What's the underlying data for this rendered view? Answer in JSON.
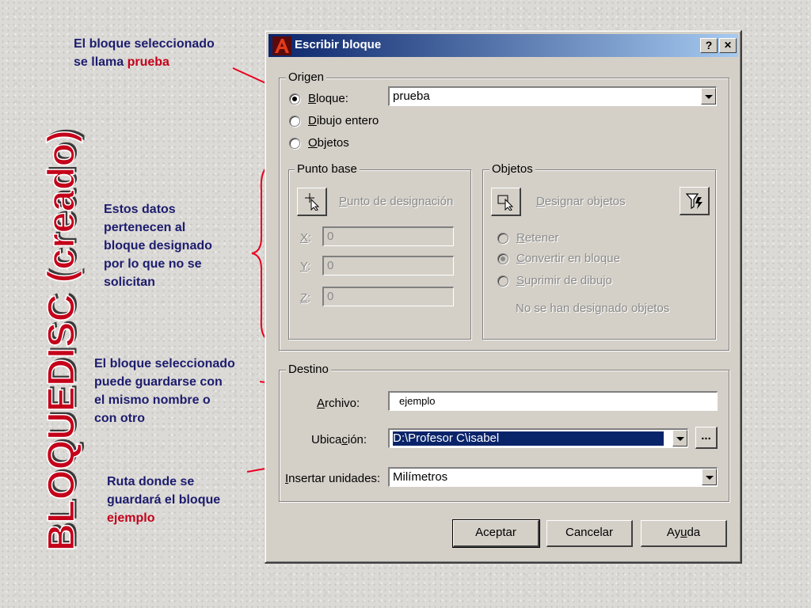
{
  "slide": {
    "title": "BLOQUEDISC (creado)",
    "title_color": "#c4001a",
    "annotations": {
      "a1_line1": "El bloque seleccionado",
      "a1_line2_pre": "se llama ",
      "a1_line2_hl": "prueba",
      "a2_lines": [
        "Estos datos",
        "pertenecen al",
        "bloque designado",
        "por lo que no se",
        "solicitan"
      ],
      "a3_lines": [
        "El bloque seleccionado",
        "puede guardarse con",
        "el mismo nombre o",
        "con otro"
      ],
      "a4_line1": "Ruta donde se",
      "a4_line2": "guardará el bloque",
      "a4_line3_hl": "ejemplo"
    }
  },
  "dialog": {
    "title": "Escribir bloque",
    "help_btn": "?",
    "close_btn": "✕",
    "origen": {
      "legend": "Origen",
      "radio_bloque_u": "B",
      "radio_bloque_rest": "loque:",
      "radio_dibujo_u": "D",
      "radio_dibujo_rest": "ibujo entero",
      "radio_objetos_u": "O",
      "radio_objetos_rest": "bjetos",
      "bloque_value": "prueba"
    },
    "punto_base": {
      "legend": "Punto base",
      "pick_u": "P",
      "pick_rest": "unto de designación",
      "x_u": "X",
      "y_u": "Y",
      "z_u": "Z",
      "x_value": "0",
      "y_value": "0",
      "z_value": "0"
    },
    "objetos": {
      "legend": "Objetos",
      "select_u": "D",
      "select_rest": "esignar objetos",
      "retener_u": "R",
      "retener_rest": "etener",
      "convertir_u": "C",
      "convertir_rest": "onvertir en bloque",
      "suprimir_u": "S",
      "suprimir_rest": "uprimir de dibujo",
      "status": "No se han designado objetos"
    },
    "destino": {
      "legend": "Destino",
      "archivo_label_pre": "A",
      "archivo_label_rest": "rchivo:",
      "archivo_value": "ejemplo",
      "ubicacion_label_pre": "Ubica",
      "ubicacion_label_u": "c",
      "ubicacion_label_rest": "ión:",
      "ubicacion_value": "D:\\Profesor C\\isabel",
      "browse_label": "...",
      "unidades_label_u": "I",
      "unidades_label_rest": "nsertar unidades:",
      "unidades_value": "Milímetros"
    },
    "buttons": {
      "ok": "Aceptar",
      "cancel": "Cancelar",
      "help_pre": "Ay",
      "help_u": "u",
      "help_rest": "da"
    },
    "colors": {
      "titlebar_start": "#0a246a",
      "titlebar_end": "#a6caf0",
      "face": "#d4d0c8",
      "selection": "#0a246a"
    }
  }
}
